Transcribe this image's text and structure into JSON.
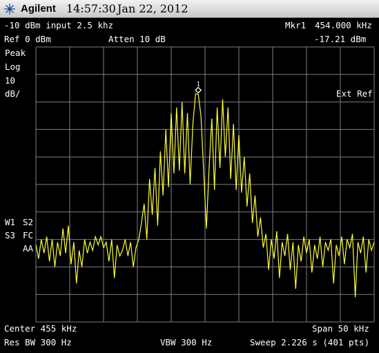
{
  "titlebar": {
    "brand": "Agilent",
    "time": "14:57:30",
    "date": "Jan 22, 2012",
    "logo_icon": "agilent-spark-icon"
  },
  "header": {
    "left_line1": "-10 dBm input 2.5 khz",
    "marker_label": "Mkr1",
    "marker_freq": "454.000 kHz",
    "ref_level": "Ref 0 dBm",
    "attenuation": "Atten 10 dB",
    "marker_amp": "-17.21 dBm"
  },
  "side_labels": {
    "detector": "Peak",
    "scale_type": "Log",
    "scale_value": "10",
    "scale_unit": "dB/",
    "ext_ref": "Ext Ref",
    "trace_w1": "W1",
    "trace_s2": "S2",
    "trace_s3": "S3",
    "trace_fc": "FC",
    "trace_aa": "AA"
  },
  "marker": {
    "number": "1"
  },
  "footer": {
    "center": "Center 455 kHz",
    "span": "Span 50 kHz",
    "res_bw": "Res BW 300 Hz",
    "vbw": "VBW 300 Hz",
    "sweep": "Sweep 2.226 s (401 pts)"
  },
  "colors": {
    "trace": "#ffff33",
    "grid": "#7f7f7f",
    "text": "#ffffff",
    "background": "#000000"
  },
  "chart_data": {
    "type": "line",
    "x_unit": "kHz",
    "y_unit": "dBm",
    "xlim": [
      430,
      480
    ],
    "ylim": [
      -100,
      0
    ],
    "grid": true,
    "points": [
      [
        430.0,
        -72
      ],
      [
        430.4,
        -77
      ],
      [
        430.8,
        -70
      ],
      [
        431.2,
        -75
      ],
      [
        431.6,
        -69
      ],
      [
        432.0,
        -78
      ],
      [
        432.4,
        -70
      ],
      [
        432.8,
        -80
      ],
      [
        433.2,
        -71
      ],
      [
        433.6,
        -76
      ],
      [
        434.0,
        -66
      ],
      [
        434.4,
        -75
      ],
      [
        434.8,
        -65
      ],
      [
        435.2,
        -79
      ],
      [
        435.6,
        -71
      ],
      [
        436.0,
        -86
      ],
      [
        436.4,
        -74
      ],
      [
        436.8,
        -80
      ],
      [
        437.2,
        -70
      ],
      [
        437.6,
        -75
      ],
      [
        438.0,
        -71
      ],
      [
        438.4,
        -74
      ],
      [
        438.8,
        -69
      ],
      [
        439.2,
        -72
      ],
      [
        439.6,
        -69
      ],
      [
        440.0,
        -73
      ],
      [
        440.4,
        -71
      ],
      [
        440.8,
        -78
      ],
      [
        441.2,
        -70
      ],
      [
        441.6,
        -84
      ],
      [
        442.0,
        -72
      ],
      [
        442.4,
        -76
      ],
      [
        442.8,
        -74
      ],
      [
        443.2,
        -70
      ],
      [
        443.6,
        -76
      ],
      [
        444.0,
        -71
      ],
      [
        444.4,
        -80
      ],
      [
        444.8,
        -73
      ],
      [
        445.2,
        -70
      ],
      [
        445.6,
        -64
      ],
      [
        446.0,
        -57
      ],
      [
        446.4,
        -70
      ],
      [
        446.8,
        -48
      ],
      [
        447.2,
        -61
      ],
      [
        447.6,
        -44
      ],
      [
        448.0,
        -65
      ],
      [
        448.4,
        -38
      ],
      [
        448.8,
        -54
      ],
      [
        449.2,
        -30
      ],
      [
        449.6,
        -51
      ],
      [
        450.0,
        -24
      ],
      [
        450.4,
        -46
      ],
      [
        450.8,
        -22
      ],
      [
        451.2,
        -45
      ],
      [
        451.6,
        -20
      ],
      [
        452.0,
        -46
      ],
      [
        452.4,
        -24
      ],
      [
        452.8,
        -50
      ],
      [
        453.2,
        -28
      ],
      [
        453.6,
        -17
      ],
      [
        454.0,
        -17.21
      ],
      [
        454.4,
        -25
      ],
      [
        454.8,
        -45
      ],
      [
        455.2,
        -66
      ],
      [
        455.6,
        -44
      ],
      [
        456.0,
        -26
      ],
      [
        456.4,
        -52
      ],
      [
        456.8,
        -22
      ],
      [
        457.2,
        -44
      ],
      [
        457.6,
        -19
      ],
      [
        458.0,
        -40
      ],
      [
        458.4,
        -22
      ],
      [
        458.8,
        -48
      ],
      [
        459.2,
        -28
      ],
      [
        459.6,
        -52
      ],
      [
        460.0,
        -32
      ],
      [
        460.4,
        -53
      ],
      [
        460.8,
        -40
      ],
      [
        461.2,
        -58
      ],
      [
        461.6,
        -46
      ],
      [
        462.0,
        -64
      ],
      [
        462.4,
        -54
      ],
      [
        462.8,
        -69
      ],
      [
        463.2,
        -62
      ],
      [
        463.6,
        -73
      ],
      [
        464.0,
        -68
      ],
      [
        464.4,
        -81
      ],
      [
        464.8,
        -70
      ],
      [
        465.2,
        -77
      ],
      [
        465.6,
        -67
      ],
      [
        466.0,
        -84
      ],
      [
        466.4,
        -71
      ],
      [
        466.8,
        -76
      ],
      [
        467.2,
        -68
      ],
      [
        467.6,
        -81
      ],
      [
        468.0,
        -71
      ],
      [
        468.4,
        -88
      ],
      [
        468.8,
        -72
      ],
      [
        469.2,
        -78
      ],
      [
        469.6,
        -69
      ],
      [
        470.0,
        -75
      ],
      [
        470.4,
        -70
      ],
      [
        470.8,
        -82
      ],
      [
        471.2,
        -72
      ],
      [
        471.6,
        -77
      ],
      [
        472.0,
        -69
      ],
      [
        472.4,
        -80
      ],
      [
        472.8,
        -71
      ],
      [
        473.2,
        -74
      ],
      [
        473.6,
        -70
      ],
      [
        474.0,
        -86
      ],
      [
        474.4,
        -72
      ],
      [
        474.8,
        -76
      ],
      [
        475.2,
        -69
      ],
      [
        475.6,
        -79
      ],
      [
        476.0,
        -70
      ],
      [
        476.4,
        -73
      ],
      [
        476.8,
        -68
      ],
      [
        477.2,
        -91
      ],
      [
        477.6,
        -71
      ],
      [
        478.0,
        -75
      ],
      [
        478.4,
        -69
      ],
      [
        478.8,
        -82
      ],
      [
        479.2,
        -70
      ],
      [
        479.6,
        -74
      ],
      [
        480.0,
        -71
      ]
    ],
    "marker": {
      "x": 454.0,
      "y": -17.21
    }
  }
}
